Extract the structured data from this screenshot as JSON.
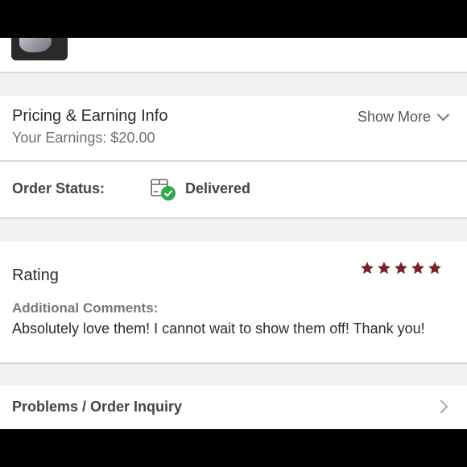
{
  "pricing": {
    "title": "Pricing & Earning Info",
    "earnings": "Your Earnings: $20.00",
    "show_more": "Show More"
  },
  "order_status": {
    "label": "Order Status:",
    "value": "Delivered",
    "icon": "delivered-box-check-icon"
  },
  "rating": {
    "title": "Rating",
    "stars": 5,
    "star_color": "#7a1f2b",
    "comments_label": "Additional Comments:",
    "comments": "Absolutely love them! I cannot wait to show them off! Thank you!"
  },
  "inquiry": {
    "label": "Problems / Order Inquiry"
  },
  "colors": {
    "accent_green": "#2ea84a",
    "section_gap": "#f1f1f1"
  }
}
